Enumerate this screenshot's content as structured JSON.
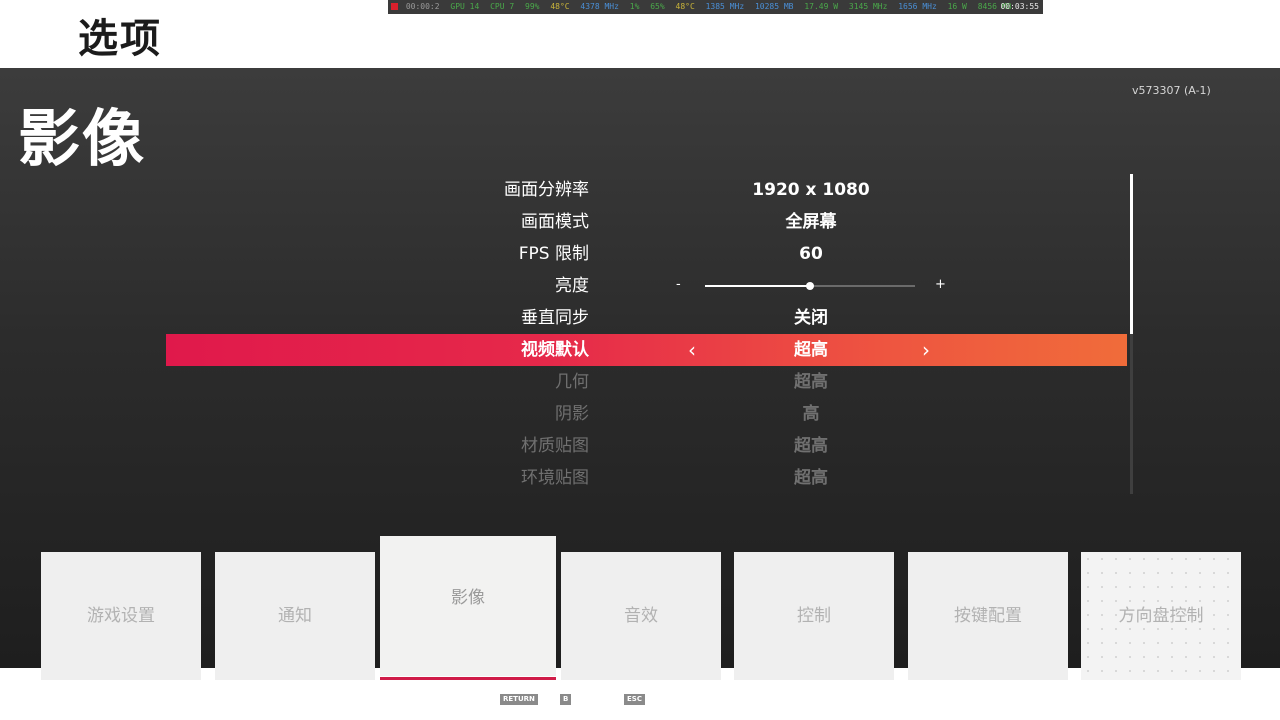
{
  "header": {
    "title": "选项",
    "perf_overlay": {
      "segments": [
        "00:00:2",
        "GPU 14",
        "CPU 7",
        "99%",
        "48°C",
        "4378 MHz",
        "1%",
        "65%",
        "48°C",
        "1385 MHz",
        "10285 MB",
        "17.49 W",
        "3145 MHz",
        "1656 MHz",
        "16 W",
        "8456 MB"
      ],
      "clock": "00:03:55"
    }
  },
  "section": {
    "title": "影像",
    "version": "v573307 (A-1)"
  },
  "settings": {
    "rows": [
      {
        "label": "画面分辨率",
        "value": "1920 x 1080"
      },
      {
        "label": "画面模式",
        "value": "全屏幕"
      },
      {
        "label": "FPS 限制",
        "value": "60"
      },
      {
        "label": "亮度",
        "value": null,
        "slider": {
          "minus": "-",
          "plus": "+",
          "level": 0.5
        }
      },
      {
        "label": "垂直同步",
        "value": "关闭"
      },
      {
        "label": "视频默认",
        "value": "超高",
        "selected": true
      },
      {
        "label": "几何",
        "value": "超高"
      },
      {
        "label": "阴影",
        "value": "高"
      },
      {
        "label": "材质贴图",
        "value": "超高"
      },
      {
        "label": "环境贴图",
        "value": "超高"
      }
    ],
    "selected_arrows": {
      "left": "‹",
      "right": "›"
    },
    "scroll_position": 0.5
  },
  "tabs": [
    {
      "label": "游戏设置"
    },
    {
      "label": "通知"
    },
    {
      "label": "影像",
      "active": true
    },
    {
      "label": "音效"
    },
    {
      "label": "控制"
    },
    {
      "label": "按键配置"
    },
    {
      "label": "方向盘控制"
    }
  ],
  "footer": {
    "keys": [
      "RETURN",
      "B",
      "ESC"
    ]
  },
  "colors": {
    "selected_gradient_start": "#e0194b",
    "selected_gradient_end": "#f06c3a",
    "active_tab_underline": "#d01c48",
    "panel_background": "#2c2c2c"
  }
}
